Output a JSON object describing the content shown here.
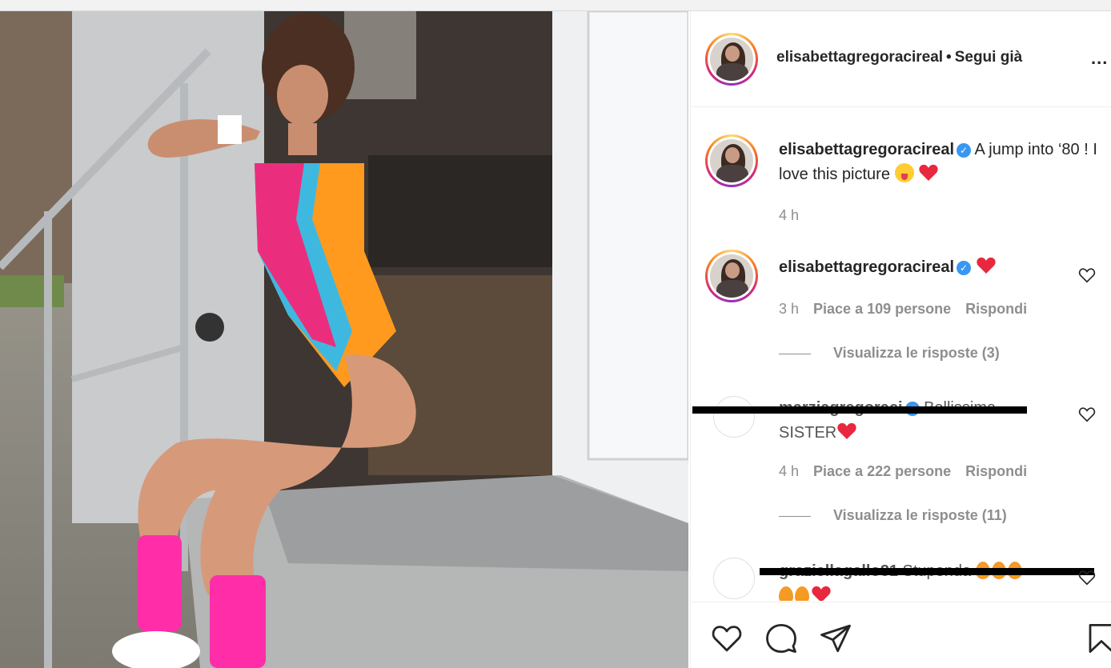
{
  "header": {
    "username": "elisabettagregoracireal",
    "separator": "•",
    "follow_status": "Segui già",
    "more": "..."
  },
  "caption": {
    "username": "elisabettagregoracireal",
    "text": "A jump into ‘80 ! I love this picture",
    "time": "4 h"
  },
  "comments": [
    {
      "username": "elisabettagregoracireal",
      "time": "3 h",
      "likes": "Piace a 109 persone",
      "reply": "Rispondi",
      "view_replies": "Visualizza le risposte (3)"
    },
    {
      "username": "marziagregoraci",
      "text": "Bellissima",
      "text_2": "SISTER",
      "time": "4 h",
      "likes": "Piace a 222 persone",
      "reply": "Rispondi",
      "view_replies": "Visualizza le risposte (11)"
    },
    {
      "username": "graziellagallo81",
      "text": "Stupenda"
    }
  ],
  "colors": {
    "verified": "#3897f0",
    "heart_red": "#ed4956",
    "meta_gray": "#8e8e8e"
  },
  "icons": [
    "like-icon",
    "comment-icon",
    "share-icon",
    "save-icon",
    "verified-icon",
    "small-heart-icon"
  ]
}
